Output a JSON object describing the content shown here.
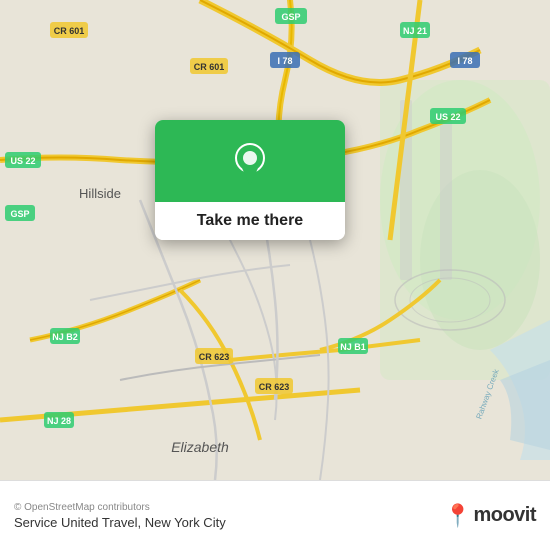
{
  "map": {
    "attribution": "© OpenStreetMap contributors",
    "background_color": "#e8e4d8"
  },
  "popup": {
    "button_label": "Take me there",
    "pin_color": "#2db855"
  },
  "bottom_bar": {
    "copyright": "© OpenStreetMap contributors",
    "location_name": "Service United Travel, New York City",
    "logo_text": "moovit"
  }
}
